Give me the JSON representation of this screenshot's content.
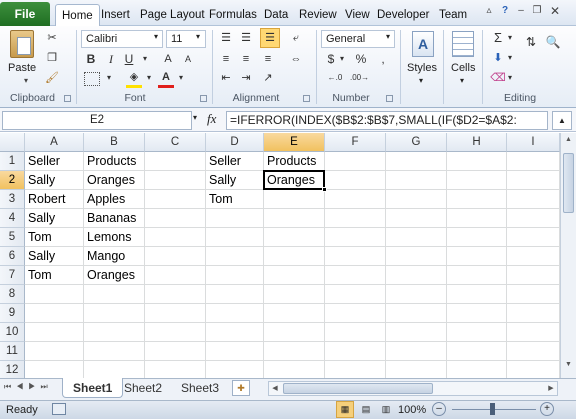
{
  "menu": {
    "file": "File",
    "tabs": [
      "Home",
      "Insert",
      "Page Layout",
      "Formulas",
      "Data",
      "Review",
      "View",
      "Developer",
      "Team"
    ]
  },
  "ribbon": {
    "paste_label": "Paste",
    "font_name": "Calibri",
    "font_size": "11",
    "number_format": "General",
    "styles_label": "Styles",
    "cells_label": "Cells",
    "groups": [
      "Clipboard",
      "Font",
      "Alignment",
      "Number",
      "Editing"
    ]
  },
  "formula_bar": {
    "name_box": "E2",
    "fx": "fx",
    "formula": "=IFERROR(INDEX($B$2:$B$7,SMALL(IF($D2=$A$2:"
  },
  "columns": [
    "A",
    "B",
    "C",
    "D",
    "E",
    "F",
    "G",
    "H",
    "I"
  ],
  "rows": [
    "1",
    "2",
    "3",
    "4",
    "5",
    "6",
    "7",
    "8",
    "9",
    "10",
    "11",
    "12"
  ],
  "cells": {
    "A1": "Seller",
    "B1": "Products",
    "A2": "Sally",
    "B2": "Oranges",
    "A3": "Robert",
    "B3": "Apples",
    "A4": "Sally",
    "B4": "Bananas",
    "A5": "Tom",
    "B5": "Lemons",
    "A6": "Sally",
    "B6": "Mango",
    "A7": "Tom",
    "B7": "Oranges",
    "D1": "Seller",
    "E1": "Products",
    "D2": "Sally",
    "E2": "Oranges",
    "D3": "Tom"
  },
  "sheets": [
    "Sheet1",
    "Sheet2",
    "Sheet3"
  ],
  "status": {
    "ready": "Ready",
    "zoom": "100%"
  }
}
